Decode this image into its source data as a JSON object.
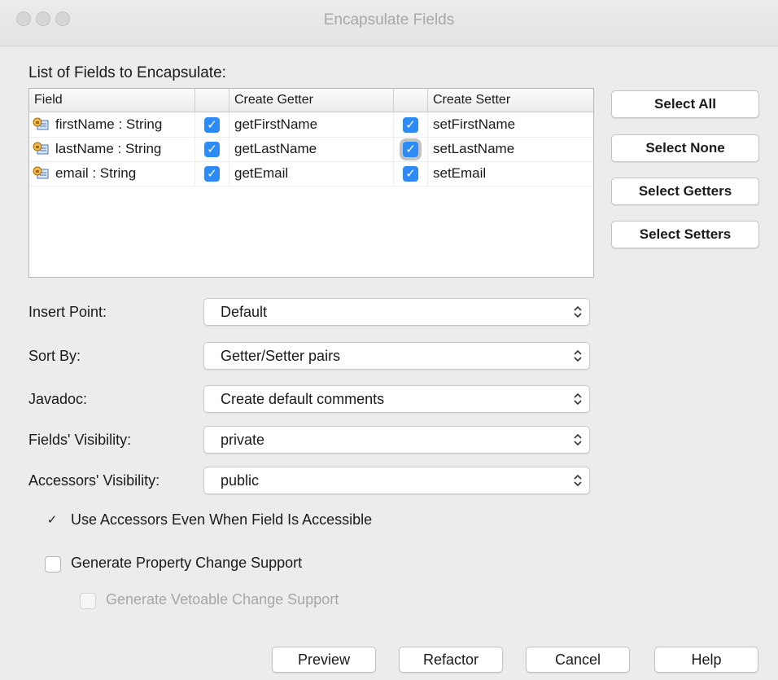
{
  "window": {
    "title": "Encapsulate Fields"
  },
  "fields_section": {
    "label": "List of Fields to Encapsulate:"
  },
  "table": {
    "headers": [
      "Field",
      "Create Getter",
      "Create Setter"
    ],
    "rows": [
      {
        "field": "firstName : String",
        "getter_checked": true,
        "getter": "getFirstName",
        "setter_checked": true,
        "setter": "setFirstName"
      },
      {
        "field": "lastName : String",
        "getter_checked": true,
        "getter": "getLastName",
        "setter_checked": true,
        "setter": "setLastName"
      },
      {
        "field": "email : String",
        "getter_checked": true,
        "getter": "getEmail",
        "setter_checked": true,
        "setter": "setEmail"
      }
    ]
  },
  "side_buttons": {
    "select_all": "Select All",
    "select_none": "Select None",
    "select_getters": "Select Getters",
    "select_setters": "Select Setters"
  },
  "options": {
    "insert_point": {
      "label": "Insert Point:",
      "value": "Default"
    },
    "sort_by": {
      "label": "Sort By:",
      "value": "Getter/Setter pairs"
    },
    "javadoc": {
      "label": "Javadoc:",
      "value": "Create default comments"
    },
    "fields_visibility": {
      "label": "Fields' Visibility:",
      "value": "private"
    },
    "accessors_visibility": {
      "label": "Accessors' Visibility:",
      "value": "public"
    }
  },
  "checkboxes": {
    "use_accessors": {
      "label": "Use Accessors Even When Field Is Accessible",
      "checked": true
    },
    "property_change": {
      "label": "Generate Property Change Support",
      "checked": false
    },
    "vetoable_change": {
      "label": "Generate Vetoable Change Support",
      "checked": false,
      "enabled": false
    }
  },
  "footer_buttons": {
    "preview": "Preview",
    "refactor": "Refactor",
    "cancel": "Cancel",
    "help": "Help"
  },
  "colors": {
    "checkbox_accent": "#2c8bf6",
    "window_background": "#ececec"
  },
  "icons": {
    "field": "field-icon",
    "check": "checkmark-icon",
    "select_arrows": "updown-chevron-icon"
  }
}
